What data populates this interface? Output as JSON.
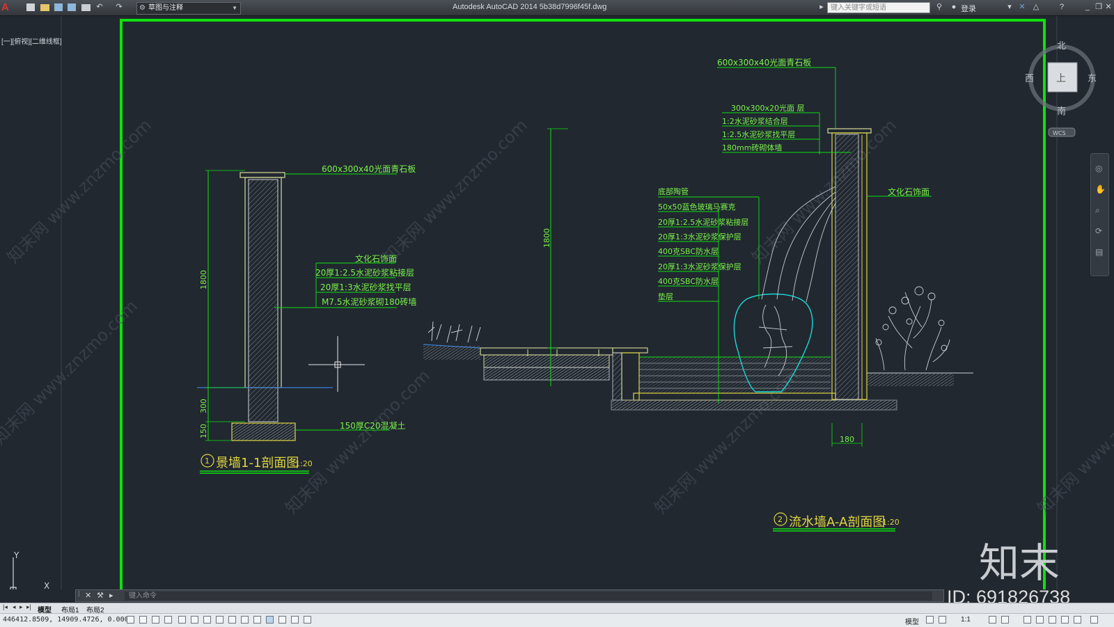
{
  "titlebar": {
    "app_logo": "A",
    "workspace": "草图与注释",
    "title": "Autodesk AutoCAD 2014    5b38d7996f45f.dwg",
    "search_placeholder": "键入关键字或短语",
    "login": "登录"
  },
  "viewport": {
    "label": "[一][俯视][二维线框]",
    "viewcube": {
      "top": "上",
      "north": "北",
      "south": "南",
      "east": "东",
      "west": "西",
      "wcs": "WCS"
    },
    "ucs": {
      "x": "X",
      "y": "Y"
    }
  },
  "drawing_left": {
    "callout_top": "600x300x40光面青石板",
    "callout_main": "文化石饰面",
    "layers": [
      "20厚1:2.5水泥砂浆粘接层",
      "20厚1:3水泥砂浆找平层",
      "M7.5水泥砂浆砌180砖墙"
    ],
    "foundation": "150厚C20混凝土",
    "dims": [
      "1800",
      "300",
      "150"
    ],
    "title_num": "1",
    "title": "景墙1-1剖面图",
    "scale": "1:20"
  },
  "drawing_right": {
    "callout_top": "600x300x40光面青石板",
    "upper_layers": [
      "300x300x20光面 层",
      "1:2水泥砂浆结合层",
      "1:2.5水泥砂浆找平层",
      "180mm砖砌体墙"
    ],
    "callout_side": "文化石饰面",
    "pond_layers": [
      "底部陶管",
      "50x50蓝色玻璃马赛克",
      "20厚1:2.5水泥砂浆粘接层",
      "20厚1:3水泥砂浆保护层",
      "400克SBC防水层",
      "20厚1:3水泥砂浆保护层",
      "400克SBC防水层",
      "垫层"
    ],
    "dim_height": "1800",
    "dim_width": "180",
    "title_num": "2",
    "title": "流水墙A-A剖面图",
    "scale": "1:20"
  },
  "watermark": "知末网 www.znzmo.com",
  "brand": {
    "logo": "知末",
    "id": "ID: 691826738"
  },
  "cmdline": {
    "placeholder": "键入命令"
  },
  "tabs": [
    "模型",
    "布局1",
    "布局2"
  ],
  "status": {
    "coords": "446412.8509, 14909.4726, 0.0000",
    "model": "模型",
    "scale": "1:1"
  }
}
